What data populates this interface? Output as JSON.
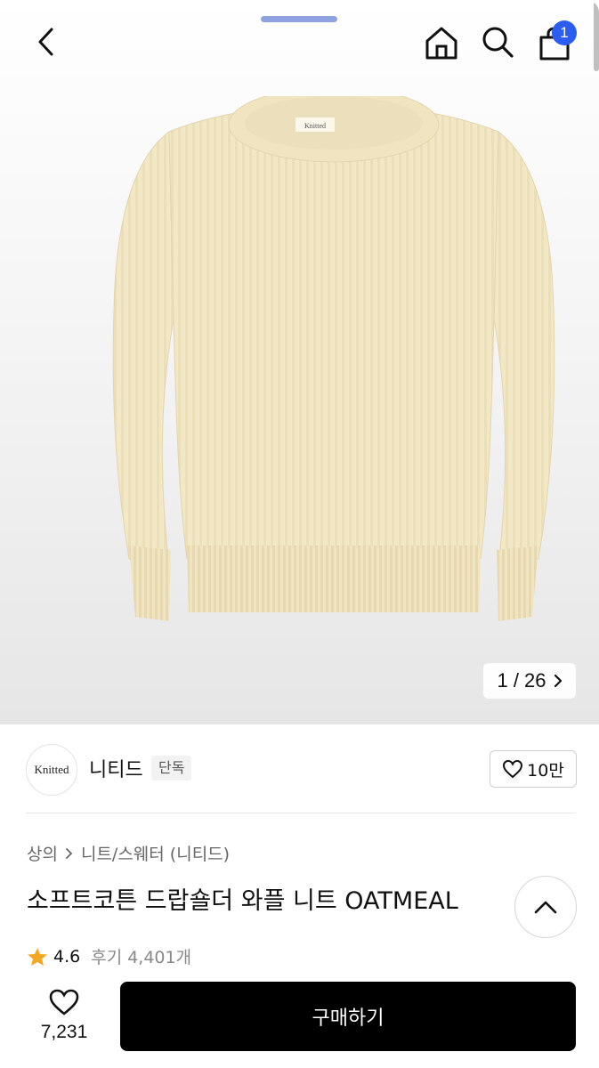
{
  "header": {
    "cart_count": "1",
    "icons": [
      "chevron-left-icon",
      "home-icon",
      "search-icon",
      "shopping-bag-icon"
    ]
  },
  "gallery": {
    "current": "1",
    "total": "26",
    "counter_text": "1 / 26",
    "logo_text": "Knitted"
  },
  "brand": {
    "logo_text": "Knitted",
    "name": "니티드",
    "tag": "단독",
    "likes": "10만"
  },
  "product": {
    "breadcrumb": [
      "상의",
      "니트/스웨터 (니티드)"
    ],
    "title": "소프트코튼 드랍숄더 와플 니트 OATMEAL",
    "rating": "4.6",
    "reviews": "후기 4,401개"
  },
  "bottom": {
    "wish_count": "7,231",
    "buy_label": "구매하기"
  },
  "colors": {
    "accent": "#2a5df0",
    "star": "#f5a623",
    "buy_button": "#000000",
    "sweater": "#f3e8c6"
  }
}
